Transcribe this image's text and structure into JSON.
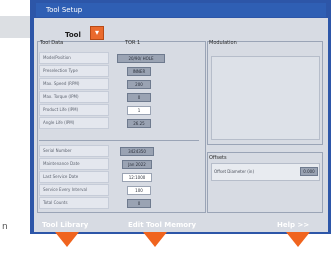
{
  "window": {
    "title": "Tool Setup"
  },
  "tool_selector": {
    "label": "Tool",
    "button_glyph": "▾"
  },
  "tool_data": {
    "group_title": "Tool Data",
    "column_title": "TOR 1",
    "rows": [
      {
        "label": "Mode/Position",
        "value": "20/90/ HOLE"
      },
      {
        "label": "Preselection Type",
        "value": "INNER"
      },
      {
        "label": "Max. Speed (RPM)",
        "value": "200"
      },
      {
        "label": "Max. Torque (IPM)",
        "value": "0"
      },
      {
        "label": "Product Life (IPM)",
        "value": "1"
      },
      {
        "label": "Angle Life (IPM)",
        "value": "26.25"
      },
      {
        "label": "Serial Number",
        "value": "3424350"
      },
      {
        "label": "Maintenance Date",
        "value": "Jan 2022"
      },
      {
        "label": "Last Service Date",
        "value": "12:1000"
      },
      {
        "label": "Service Every Interval",
        "value": "100"
      },
      {
        "label": "Total Counts",
        "value": "0"
      }
    ]
  },
  "modulation": {
    "group_title": "Modulation"
  },
  "offsets": {
    "group_title": "Offsets",
    "row_label": "Offset Diameter (in)",
    "row_value": "0.000"
  },
  "bottom_buttons": [
    {
      "label": "Tool Library",
      "icon": "down-arrow-icon"
    },
    {
      "label": "Edit Tool Memory",
      "icon": "down-arrow-icon"
    },
    {
      "label": "Help >>",
      "icon": "down-arrow-icon"
    }
  ],
  "edge_text": "n",
  "colors": {
    "window": "#2d56a8",
    "client": "#d7dbe3",
    "accent": "#f0641e"
  }
}
